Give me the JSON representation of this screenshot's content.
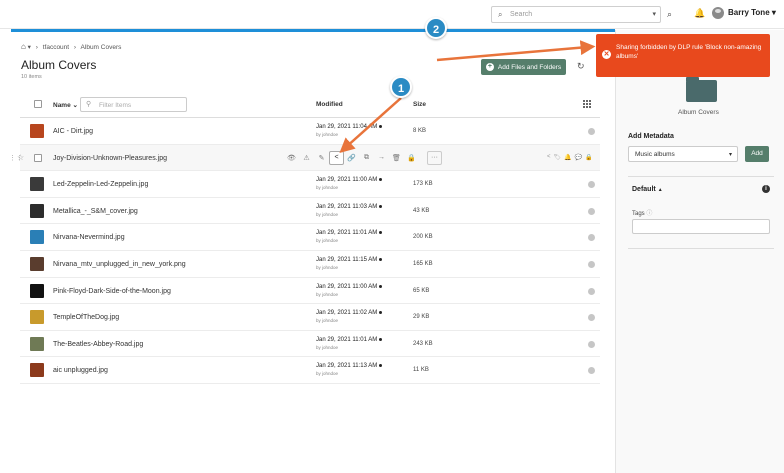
{
  "topbar": {
    "search_placeholder": "Search",
    "search_icon": "search-icon",
    "user_name": "Barry Tone",
    "user_caret": "▾"
  },
  "breadcrumb": {
    "home_caret": "▾",
    "sep": "›",
    "items": [
      "tfaccount",
      "Album Covers"
    ]
  },
  "header": {
    "title": "Album Covers",
    "subtitle": "10 items",
    "add_button": "Add Files and Folders"
  },
  "table": {
    "col_name": "Name",
    "name_sort": "⌄",
    "filter_placeholder": "Filter Items",
    "col_modified": "Modified",
    "col_size": "Size",
    "rows": [
      {
        "name": "AIC - Dirt.jpg",
        "date": "Jan 29, 2021 11:04 AM",
        "by": "by johndoe",
        "size": "8 KB",
        "color": "#b8461e"
      },
      {
        "name": "Joy-Division-Unknown-Pleasures.jpg",
        "date": "",
        "by": "",
        "size": "",
        "color": "#f0f0f0"
      },
      {
        "name": "Led-Zeppelin-Led-Zeppelin.jpg",
        "date": "Jan 29, 2021 11:00 AM",
        "by": "by johndoe",
        "size": "173 KB",
        "color": "#3a3a3a"
      },
      {
        "name": "Metallica_-_S&M_cover.jpg",
        "date": "Jan 29, 2021 11:03 AM",
        "by": "by johndoe",
        "size": "43 KB",
        "color": "#2c2c2c"
      },
      {
        "name": "Nirvana-Nevermind.jpg",
        "date": "Jan 29, 2021 11:01 AM",
        "by": "by johndoe",
        "size": "200 KB",
        "color": "#2a7fb6"
      },
      {
        "name": "Nirvana_mtv_unplugged_in_new_york.png",
        "date": "Jan 29, 2021 11:15 AM",
        "by": "by johndoe",
        "size": "165 KB",
        "color": "#5a3d2e"
      },
      {
        "name": "Pink-Floyd-Dark-Side-of-the-Moon.jpg",
        "date": "Jan 29, 2021 11:00 AM",
        "by": "by johndoe",
        "size": "65 KB",
        "color": "#111111"
      },
      {
        "name": "TempleOfTheDog.jpg",
        "date": "Jan 29, 2021 11:02 AM",
        "by": "by johndoe",
        "size": "29 KB",
        "color": "#c89a2c"
      },
      {
        "name": "The-Beatles-Abbey-Road.jpg",
        "date": "Jan 29, 2021 11:01 AM",
        "by": "by johndoe",
        "size": "243 KB",
        "color": "#6f7a55"
      },
      {
        "name": "aic unplugged.jpg",
        "date": "Jan 29, 2021 11:13 AM",
        "by": "by johndoe",
        "size": "11 KB",
        "color": "#8c3a1c"
      }
    ],
    "row_actions": [
      "👁",
      "⚠",
      "✎",
      "<",
      "🔗",
      "⧉",
      "→",
      "🗑",
      "🔒"
    ],
    "more": "···",
    "row_tail": [
      "<",
      "🏷",
      "🔔",
      "💬",
      "🔒"
    ]
  },
  "right_panel": {
    "folder_label": "Album Covers",
    "add_metadata_title": "Add Metadata",
    "metadata_select": "Music albums",
    "metadata_add": "Add",
    "default_label": "Default",
    "default_caret": "▲",
    "tags_label": "Tags"
  },
  "toast": {
    "message": "Sharing forbidden by DLP rule 'Block non-amazing albums'",
    "color": "#e8491d"
  },
  "callouts": [
    "1",
    "2"
  ],
  "colors": {
    "accent_blue": "#1e8fd8",
    "button_green": "#557e6b",
    "callout_blue": "#2a8bc4",
    "arrow_orange": "#e8743b"
  }
}
